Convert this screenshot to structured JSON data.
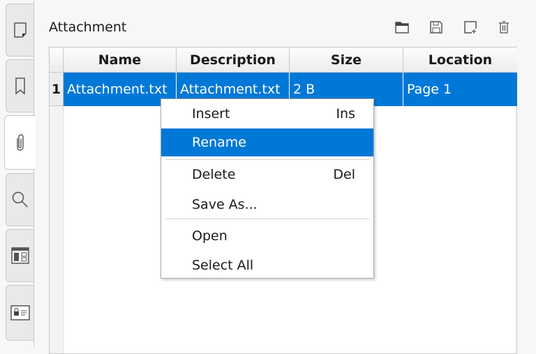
{
  "sidebar": {
    "tabs": [
      {
        "name": "pages",
        "icon": "page-icon"
      },
      {
        "name": "bookmarks",
        "icon": "bookmark-icon"
      },
      {
        "name": "attachments",
        "icon": "paperclip-icon",
        "active": true
      },
      {
        "name": "search",
        "icon": "search-icon"
      },
      {
        "name": "structure",
        "icon": "structure-icon"
      },
      {
        "name": "signatures",
        "icon": "signature-icon"
      }
    ]
  },
  "panel": {
    "title": "Attachment",
    "toolbar": [
      "folder-open-icon",
      "save-icon",
      "add-icon",
      "trash-icon"
    ]
  },
  "table": {
    "columns": [
      "Name",
      "Description",
      "Size",
      "Location"
    ],
    "rows": [
      {
        "num": "1",
        "name": "Attachment.txt",
        "description": "Attachment.txt",
        "size": "2 B",
        "location": "Page 1"
      }
    ]
  },
  "context_menu": {
    "items": [
      {
        "label": "Insert",
        "shortcut": "Ins"
      },
      {
        "label": "Rename",
        "shortcut": ""
      },
      {
        "label": "Delete",
        "shortcut": "Del"
      },
      {
        "label": "Save As...",
        "shortcut": ""
      },
      {
        "label": "Open",
        "shortcut": ""
      },
      {
        "label": "Select All",
        "shortcut": ""
      }
    ],
    "highlighted": "Rename"
  },
  "colors": {
    "selection": "#0078d7"
  }
}
